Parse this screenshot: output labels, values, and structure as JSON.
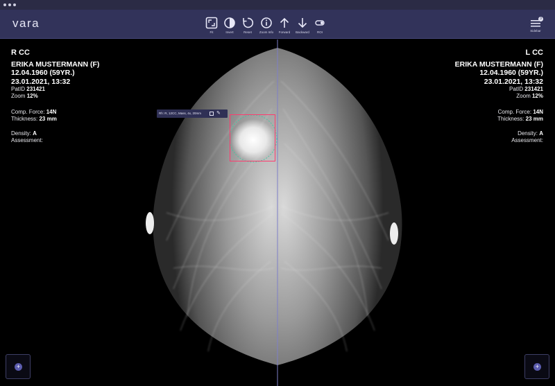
{
  "app": {
    "logo": "vara"
  },
  "toolbar": {
    "tools": [
      {
        "id": "fit",
        "label": "Fit",
        "icon": "fit-icon"
      },
      {
        "id": "invert",
        "label": "Invert",
        "icon": "invert-icon"
      },
      {
        "id": "reset",
        "label": "Reset",
        "icon": "reset-icon"
      },
      {
        "id": "zoom-info",
        "label": "Zoom Info",
        "icon": "info-icon"
      },
      {
        "id": "forward",
        "label": "Forward",
        "icon": "arrow-up-icon"
      },
      {
        "id": "backward",
        "label": "Backward",
        "icon": "arrow-down-icon"
      },
      {
        "id": "roi",
        "label": "ROI",
        "icon": "toggle-icon"
      }
    ],
    "sidebar_label": "Sidebar",
    "sidebar_badge": "3"
  },
  "left": {
    "view": "R CC",
    "name": "ERIKA MUSTERMANN (F)",
    "dob": "12.04.1960 (59YR.)",
    "date": "23.01.2021, 13:32",
    "patid_label": "PatID",
    "patid": "231421",
    "zoom_label": "Zoom",
    "zoom": "12%",
    "force_label": "Comp. Force:",
    "force": "14N",
    "thickness_label": "Thickness:",
    "thickness": "23 mm",
    "density_label": "Density:",
    "density": "A",
    "assessment_label": "Assessment:"
  },
  "right": {
    "view": "L CC",
    "name": "ERIKA MUSTERMANN (F)",
    "dob": "12.04.1960 (59YR.)",
    "date": "23.01.2021, 13:32",
    "patid_label": "PatID",
    "patid": "231421",
    "zoom_label": "Zoom",
    "zoom": "12%",
    "force_label": "Comp. Force:",
    "force": "14N",
    "thickness_label": "Thickness:",
    "thickness": "23 mm",
    "density_label": "Density:",
    "density": "A",
    "assessment_label": "Assessment:"
  },
  "annotation": {
    "text": "Rh: R, 12CC, Mass, 4x, 20mm"
  },
  "colors": {
    "toolbar": "#32335a",
    "roi": "#ff3a6e",
    "roi_circle": "#3ec9a0",
    "add_button": "#5b5cae"
  }
}
